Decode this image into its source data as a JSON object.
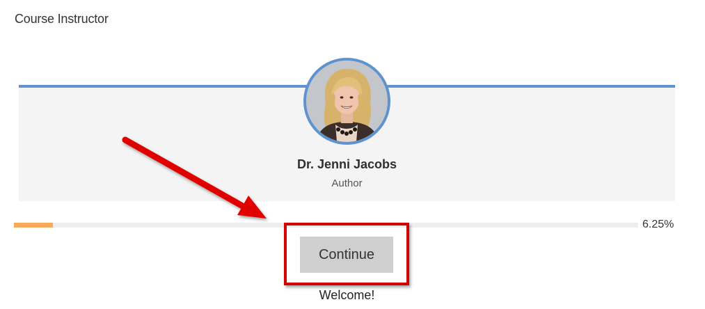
{
  "section": {
    "title": "Course Instructor"
  },
  "instructor": {
    "name": "Dr. Jenni Jacobs",
    "role": "Author",
    "avatar_icon": "instructor-photo"
  },
  "progress": {
    "percent": 6.25,
    "label": "6.25%"
  },
  "actions": {
    "continue_label": "Continue"
  },
  "status": {
    "message": "Welcome!"
  },
  "colors": {
    "accent_blue": "#5f93cf",
    "progress_orange": "#f6a95a",
    "highlight_red": "#d40000",
    "card_background": "#f4f4f4",
    "button_gray": "#cfcfd0"
  }
}
